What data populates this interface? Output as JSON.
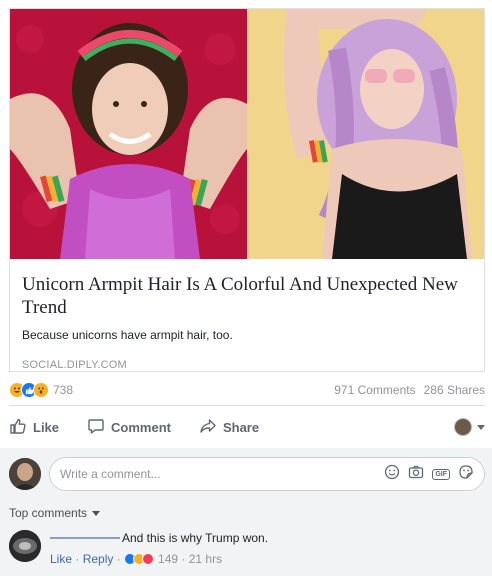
{
  "link_card": {
    "title": "Unicorn Armpit Hair Is A Colorful And Unexpected New Trend",
    "description": "Because unicorns have armpit hair, too.",
    "domain": "SOCIAL.DIPLY.COM"
  },
  "stats": {
    "reaction_count": "738",
    "comments": "971 Comments",
    "shares": "286 Shares",
    "reactions": [
      "haha",
      "like",
      "wow"
    ]
  },
  "actions": {
    "like": "Like",
    "comment": "Comment",
    "share": "Share"
  },
  "composer": {
    "placeholder": "Write a comment..."
  },
  "comments_section": {
    "sort_label": "Top comments",
    "comment": {
      "text": "And this is why Trump won.",
      "like": "Like",
      "reply": "Reply",
      "reaction_count": "149",
      "time": "21 hrs"
    }
  },
  "colors": {
    "link_blue": "#4267b2",
    "like_blue": "#1877f2",
    "muted_gray": "#90949c",
    "haha_yellow": "#f7b125",
    "love_red": "#f33e58"
  }
}
